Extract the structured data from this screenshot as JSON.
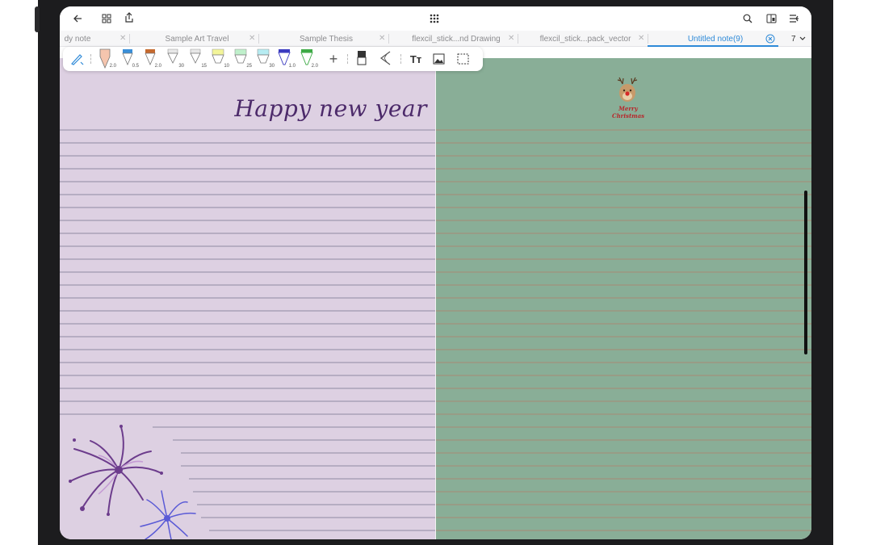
{
  "topbar": {
    "back_icon": "back-arrow-icon",
    "grid_icon": "grid-icon",
    "export_icon": "share-icon",
    "apps_icon": "apps-dots-icon",
    "search_icon": "search-icon",
    "split_icon": "split-view-icon",
    "menu_icon": "menu-icon"
  },
  "tabs": [
    {
      "label": "dy note"
    },
    {
      "label": "Sample Art Travel"
    },
    {
      "label": "Sample Thesis"
    },
    {
      "label": "flexcil_stick...nd Drawing"
    },
    {
      "label": "flexcil_stick...pack_vector"
    },
    {
      "label": "Untitled note(9)",
      "active": true
    }
  ],
  "tab_count": "7",
  "toolbar": {
    "pens": [
      {
        "size": "2.0",
        "color": "#f5c5ae"
      },
      {
        "size": "0.5",
        "color": "#3a8fd8"
      },
      {
        "size": "2.0",
        "color": "#c56a2f"
      },
      {
        "size": "30",
        "color": "#e8e8e8"
      },
      {
        "size": "15",
        "color": "#e8e8e8"
      },
      {
        "size": "10",
        "color": "#f3f59a"
      },
      {
        "size": "25",
        "color": "#bff0cb"
      },
      {
        "size": "30",
        "color": "#b6ecf2"
      },
      {
        "size": "1.0",
        "color": "#3b3bc0"
      },
      {
        "size": "2.0",
        "color": "#3eaa46"
      }
    ]
  },
  "page_left": {
    "title": "Happy new year",
    "background": "#ddd0e2",
    "line_color": "#8e8aa2"
  },
  "page_right": {
    "sticker_text_line1": "Merry",
    "sticker_text_line2": "Christmas",
    "background": "#89ae97",
    "line_color": "#a78a76"
  },
  "colors": {
    "accent": "#2e8ad8",
    "firework_purple": "#6c3c8c",
    "firework_pink": "#c49bd4",
    "firework_blue": "#5a5ad6"
  }
}
